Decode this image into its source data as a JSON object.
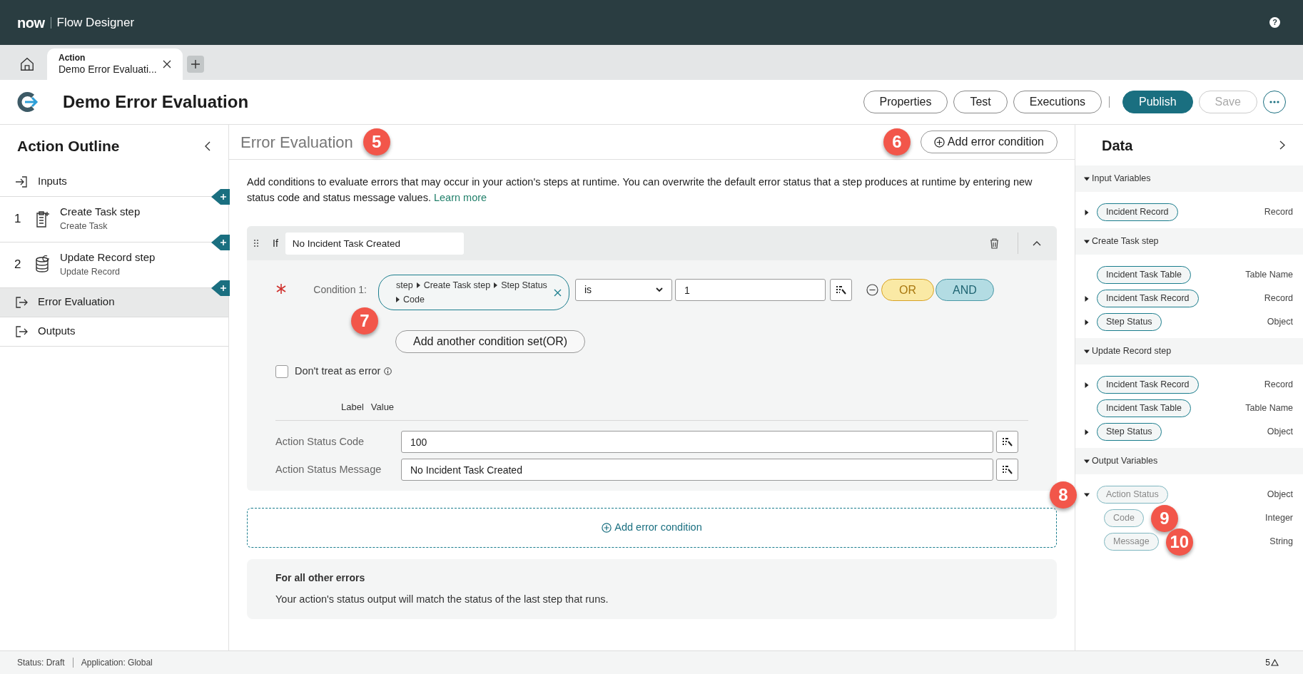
{
  "header": {
    "brand": "now",
    "app_title": "Flow Designer",
    "help_glyph": "?"
  },
  "tabs": [
    {
      "kind": "home",
      "selected": false
    },
    {
      "kind": "document",
      "title": "Action",
      "subtitle": "Demo Error Evaluati...",
      "selected": true
    }
  ],
  "title_bar": {
    "title": "Demo Error Evaluation",
    "buttons": [
      {
        "label": "Properties",
        "kind": "outline",
        "disabled": false
      },
      {
        "label": "Test",
        "kind": "outline",
        "disabled": false
      },
      {
        "label": "Executions",
        "kind": "outline",
        "disabled": false
      },
      {
        "label": "Publish",
        "kind": "primary",
        "disabled": false
      },
      {
        "label": "Save",
        "kind": "outline",
        "disabled": true
      }
    ]
  },
  "outline": {
    "title": "Action Outline",
    "items": [
      {
        "kind": "inputs",
        "label": "Inputs",
        "selected": false
      },
      {
        "kind": "step",
        "number": "1",
        "label": "Create Task step",
        "subtitle": "Create Task",
        "selected": false
      },
      {
        "kind": "step",
        "number": "2",
        "label": "Update Record step",
        "subtitle": "Update Record",
        "selected": false
      },
      {
        "kind": "error",
        "label": "Error Evaluation",
        "selected": true
      },
      {
        "kind": "outputs",
        "label": "Outputs",
        "selected": false
      }
    ]
  },
  "main": {
    "heading": "Error Evaluation",
    "heading_callout": "5",
    "add_button": {
      "label": "Add error condition",
      "callout": "6"
    },
    "description": "Add conditions to evaluate errors that may occur in your action's steps at runtime. You can overwrite the default error status that a step produces at runtime by entering new status code and status message values.",
    "learn_more": "Learn more",
    "condition_block": {
      "if_label": "If",
      "name": "No Incident Task Created",
      "expanded": true,
      "condition": {
        "required": true,
        "label": "Condition 1:",
        "path": [
          "step",
          "Create Task step",
          "Step Status",
          "Code"
        ],
        "callout": "7",
        "operator": "is",
        "value": "1",
        "or_label": "OR",
        "and_label": "AND"
      },
      "add_set_button": "Add another condition set(OR)",
      "dont_treat": {
        "label": "Don't treat as error",
        "checked": false
      },
      "columns": [
        "Label",
        "Value"
      ],
      "fields": [
        {
          "label": "Action Status Code",
          "value": "100"
        },
        {
          "label": "Action Status Message",
          "value": "No Incident Task Created"
        }
      ]
    },
    "add_condition": "Add error condition",
    "other_errors": {
      "title": "For all other errors",
      "text": "Your action's status output will match the status of the last step that runs."
    }
  },
  "data_panel": {
    "title": "Data",
    "sections": [
      {
        "title": "Input Variables",
        "items": [
          {
            "label": "Incident Record",
            "type": "Record",
            "expandable": true,
            "expanded": false,
            "disabled": false
          }
        ]
      },
      {
        "title": "Create Task step",
        "items": [
          {
            "label": "Incident Task Table",
            "type": "Table Name",
            "expandable": false,
            "disabled": false
          },
          {
            "label": "Incident Task Record",
            "type": "Record",
            "expandable": true,
            "expanded": false,
            "disabled": false
          },
          {
            "label": "Step Status",
            "type": "Object",
            "expandable": true,
            "expanded": false,
            "disabled": false
          }
        ]
      },
      {
        "title": "Update Record step",
        "items": [
          {
            "label": "Incident Task Record",
            "type": "Record",
            "expandable": true,
            "expanded": false,
            "disabled": false
          },
          {
            "label": "Incident Task Table",
            "type": "Table Name",
            "expandable": false,
            "disabled": false
          },
          {
            "label": "Step Status",
            "type": "Object",
            "expandable": true,
            "expanded": false,
            "disabled": false
          }
        ]
      },
      {
        "title": "Output Variables",
        "items": [
          {
            "label": "Action Status",
            "type": "Object",
            "expandable": true,
            "expanded": true,
            "disabled": true,
            "callout": "8",
            "children": [
              {
                "label": "Code",
                "type": "Integer",
                "expandable": false,
                "disabled": true,
                "callout": "9"
              },
              {
                "label": "Message",
                "type": "String",
                "expandable": false,
                "disabled": true,
                "callout": "10"
              }
            ]
          }
        ]
      }
    ]
  },
  "status_bar": {
    "items": [
      "Status: Draft",
      "Application: Global"
    ],
    "warning_count": "5"
  }
}
